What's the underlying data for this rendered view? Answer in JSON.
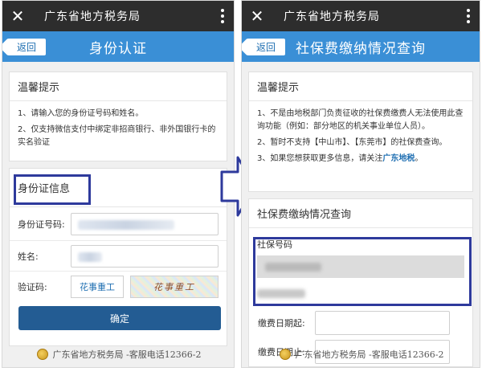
{
  "left": {
    "titlebar": {
      "title": "广东省地方税务局"
    },
    "navbar": {
      "back": "返回",
      "title": "身份认证"
    },
    "tips": {
      "heading": "温馨提示",
      "items": [
        "1、请输入您的身份证号码和姓名。",
        "2、仅支持微信支付中绑定非招商银行、非外国银行卡的实名验证"
      ]
    },
    "form": {
      "heading": "身份证信息",
      "id_label": "身份证号码:",
      "name_label": "姓名:",
      "captcha_label": "验证码:",
      "captcha_text": "花事重工",
      "captcha_image_text": "花事重工",
      "confirm": "确定"
    },
    "footer": "广东省地方税务局 -客服电话12366-2"
  },
  "right": {
    "titlebar": {
      "title": "广东省地方税务局"
    },
    "navbar": {
      "back": "返回",
      "title": "社保费缴纳情况查询"
    },
    "tips": {
      "heading": "温馨提示",
      "item1": "1、不是由地税部门负责征收的社保费缴费人无法使用此查询功能（例如：部分地区的机关事业单位人员）。",
      "item2": "2、暂时不支持【中山市】、【东莞市】的社保费查询。",
      "item3_prefix": "3、如果您想获取更多信息，请关注",
      "item3_link": "广东地税",
      "item3_suffix": "。"
    },
    "query": {
      "heading": "社保费缴纳情况查询",
      "number_label": "社保号码",
      "start_label": "缴费日期起:",
      "end_label": "缴费日期止:"
    },
    "footer": "广东省地方税务局 -客服电话12366-2"
  },
  "colors": {
    "titlebar": "#2d2d2d",
    "navbar": "#3a8fd6",
    "highlight": "#2e3a9c",
    "button": "#235c93"
  }
}
